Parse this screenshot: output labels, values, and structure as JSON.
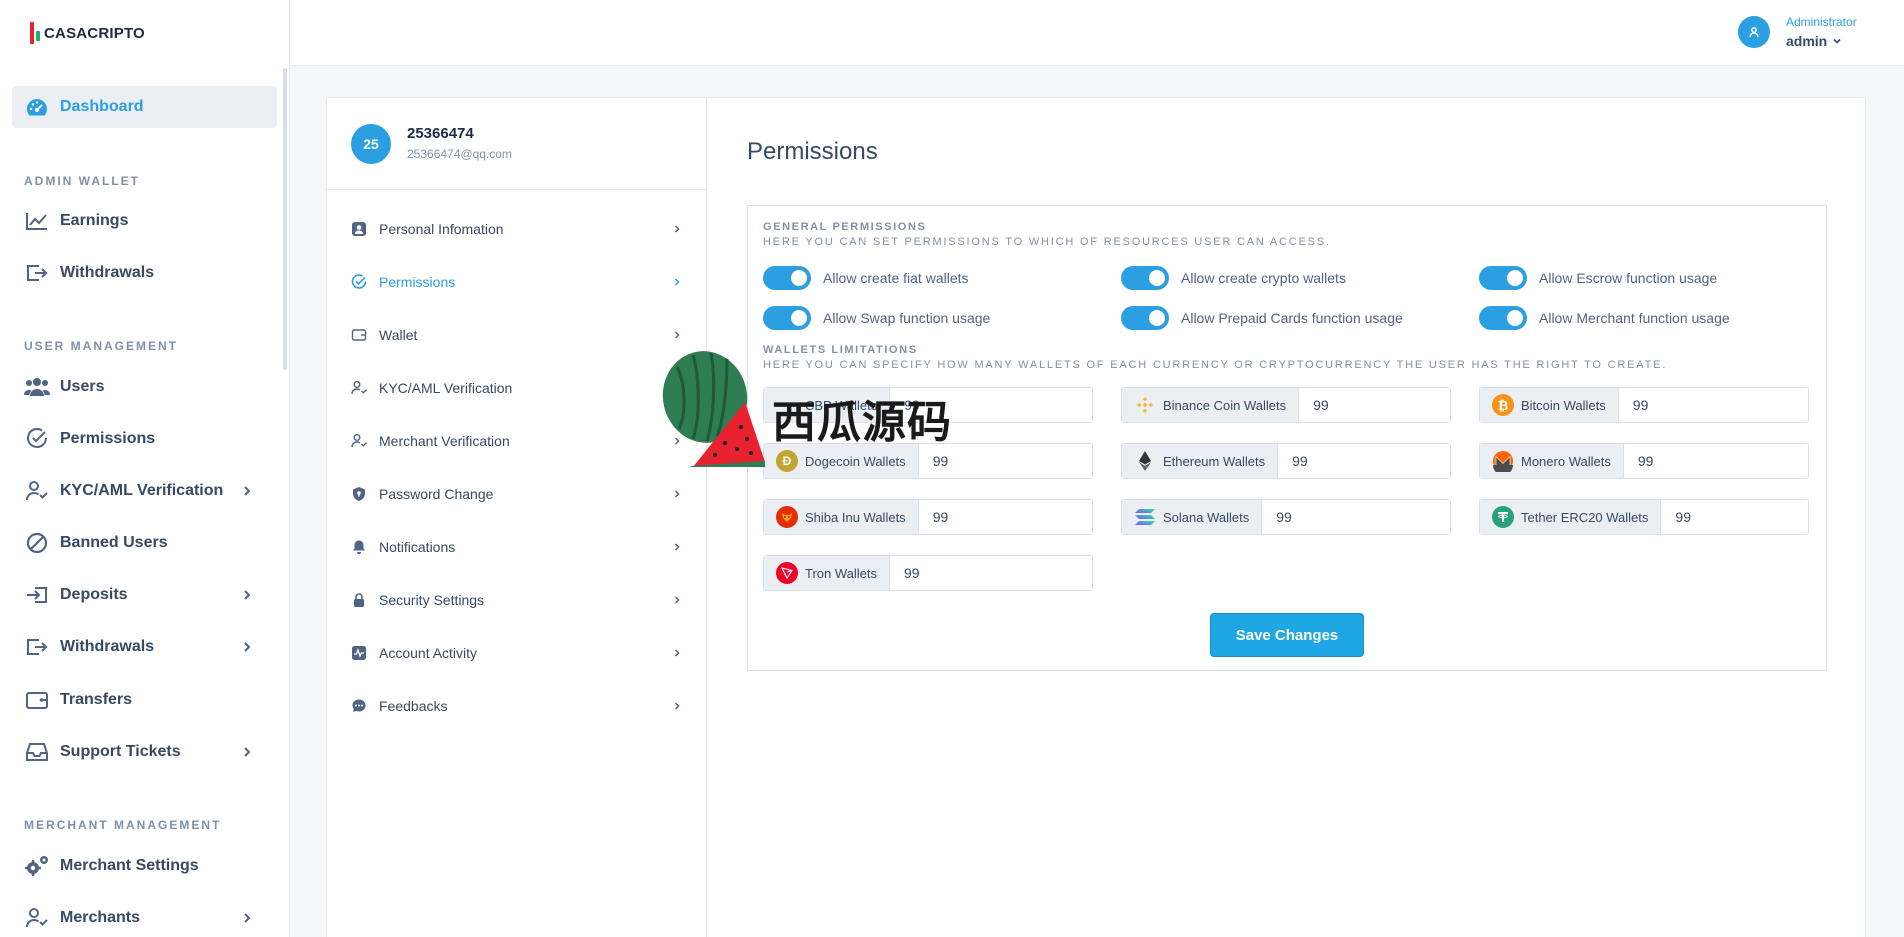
{
  "brand": {
    "name": "CASACRIPTO"
  },
  "user": {
    "role": "Administrator",
    "name": "admin"
  },
  "sidebar": {
    "dashboard": "Dashboard",
    "section_admin_wallet": "ADMIN WALLET",
    "earnings": "Earnings",
    "withdrawals_admin": "Withdrawals",
    "section_user_management": "USER MANAGEMENT",
    "users": "Users",
    "permissions": "Permissions",
    "kyc": "KYC/AML Verification",
    "banned": "Banned Users",
    "deposits": "Deposits",
    "withdrawals": "Withdrawals",
    "transfers": "Transfers",
    "support": "Support Tickets",
    "section_merchant_management": "MERCHANT MANAGEMENT",
    "merchant_settings": "Merchant Settings",
    "merchants": "Merchants"
  },
  "profile": {
    "initials": "25",
    "name": "25366474",
    "email": "25366474@qq.com"
  },
  "menu": {
    "personal": "Personal Infomation",
    "permissions": "Permissions",
    "wallet": "Wallet",
    "kyc": "KYC/AML Verification",
    "merchant": "Merchant Verification",
    "password": "Password Change",
    "notifications": "Notifications",
    "security": "Security Settings",
    "activity": "Account Activity",
    "feedbacks": "Feedbacks"
  },
  "page": {
    "title": "Permissions"
  },
  "general": {
    "title": "GENERAL PERMISSIONS",
    "subtitle": "HERE YOU CAN SET PERMISSIONS TO WHICH OF RESOURCES USER CAN ACCESS.",
    "toggles": [
      "Allow create fiat wallets",
      "Allow create crypto wallets",
      "Allow Escrow function usage",
      "Allow Swap function usage",
      "Allow Prepaid Cards function usage",
      "Allow Merchant function usage"
    ]
  },
  "limits": {
    "title": "WALLETS LIMITATIONS",
    "subtitle": "HERE YOU CAN SPECIFY HOW MANY WALLETS OF EACH CURRENCY OR CRYPTOCURRENCY THE USER HAS THE RIGHT TO CREATE.",
    "wallets": [
      {
        "label": "CBP Wallets",
        "value": "99"
      },
      {
        "label": "Binance Coin Wallets",
        "value": "99"
      },
      {
        "label": "Bitcoin Wallets",
        "value": "99"
      },
      {
        "label": "Dogecoin Wallets",
        "value": "99"
      },
      {
        "label": "Ethereum Wallets",
        "value": "99"
      },
      {
        "label": "Monero Wallets",
        "value": "99"
      },
      {
        "label": "Shiba Inu Wallets",
        "value": "99"
      },
      {
        "label": "Solana Wallets",
        "value": "99"
      },
      {
        "label": "Tether ERC20 Wallets",
        "value": "99"
      },
      {
        "label": "Tron Wallets",
        "value": "99"
      }
    ]
  },
  "actions": {
    "save": "Save Changes"
  },
  "watermark": {
    "text": "西瓜源码"
  },
  "colors": {
    "accent": "#2c9fe3",
    "button": "#1ea7e4",
    "text": "#364a63",
    "muted": "#8091a7"
  }
}
